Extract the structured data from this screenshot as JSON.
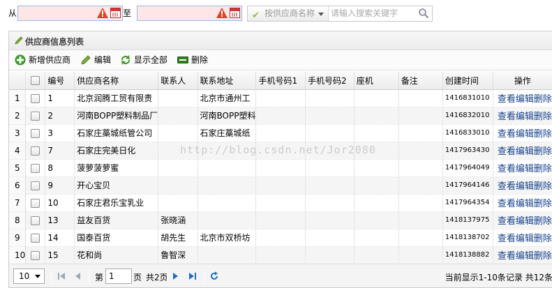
{
  "search": {
    "from_label": "从",
    "to_label": "至",
    "from_value": "",
    "to_value": "",
    "field_button": "按供应商名称",
    "keyword_placeholder": "请输入搜索关键字"
  },
  "panel": {
    "title": "供应商信息列表"
  },
  "toolbar": {
    "add_label": "新增供应商",
    "edit_label": "编辑",
    "show_all_label": "显示全部",
    "delete_label": "删除"
  },
  "grid": {
    "columns": [
      "编号",
      "供应商名称",
      "联系人",
      "联系地址",
      "手机号码1",
      "手机号码2",
      "座机",
      "备注",
      "创建时间",
      "操作"
    ],
    "rows": [
      {
        "rn": "1",
        "id": "1",
        "name": "北京润腾工贸有限责",
        "contact": "",
        "address": "北京市通州工",
        "time": "1416831010"
      },
      {
        "rn": "2",
        "id": "2",
        "name": "河南BOPP塑料制品厂",
        "contact": "",
        "address": "河南BOPP塑料",
        "time": "1416832010"
      },
      {
        "rn": "3",
        "id": "3",
        "name": "石家庄藁城纸管公司",
        "contact": "",
        "address": "石家庄藁城纸",
        "time": "1416833010"
      },
      {
        "rn": "4",
        "id": "7",
        "name": "石家庄完美日化",
        "contact": "",
        "address": "",
        "time": "1417963430"
      },
      {
        "rn": "5",
        "id": "8",
        "name": "菠萝菠萝蜜",
        "contact": "",
        "address": "",
        "time": "1417964049"
      },
      {
        "rn": "6",
        "id": "9",
        "name": "开心宝贝",
        "contact": "",
        "address": "",
        "time": "1417964146"
      },
      {
        "rn": "7",
        "id": "10",
        "name": "石家庄君乐宝乳业",
        "contact": "",
        "address": "",
        "time": "1417964354"
      },
      {
        "rn": "8",
        "id": "13",
        "name": "益友百货",
        "contact": "张晓涵",
        "address": "",
        "time": "1418137975"
      },
      {
        "rn": "9",
        "id": "14",
        "name": "国泰百货",
        "contact": "胡先生",
        "address": "北京市双桥坊",
        "time": "1418138702"
      },
      {
        "rn": "10",
        "id": "15",
        "name": "花和尚",
        "contact": "鲁智深",
        "address": "",
        "time": "1418138882"
      }
    ],
    "ops": {
      "view": "查看",
      "edit": "编辑",
      "delete": "删除"
    }
  },
  "pager": {
    "page_size": "10",
    "page_prefix": "第",
    "page_value": "1",
    "page_suffix": "页",
    "total_pages": "共2页",
    "info": "当前显示1-10条记录 共12条"
  },
  "watermark": "http://blog.csdn.net/Jor2080",
  "colors": {
    "accent": "#15428b",
    "date_bg": "#ffe6e6",
    "border": "#95b8e7"
  }
}
